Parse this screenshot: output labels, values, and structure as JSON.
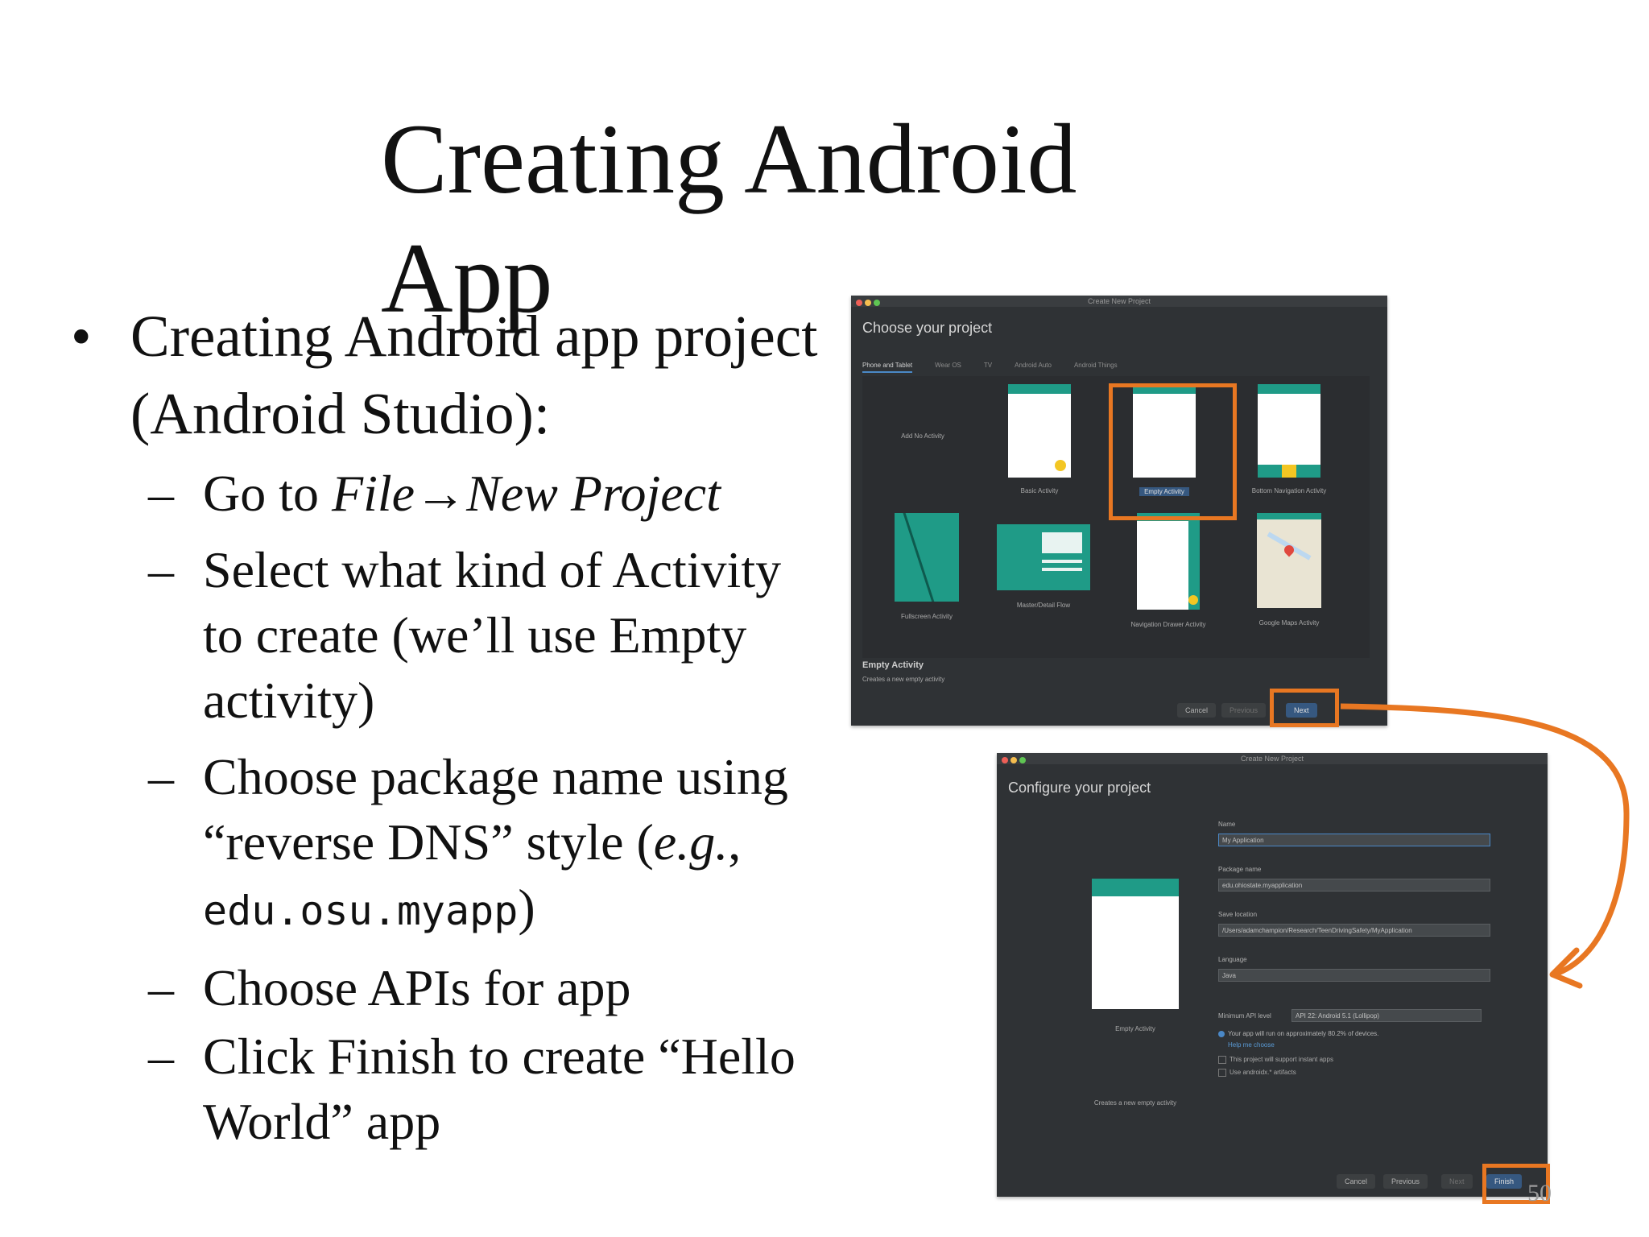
{
  "slide": {
    "title": "Creating Android App",
    "bullet_main_1": "Creating Android app project (Android Studio):",
    "sub1_prefix": "Go to ",
    "sub1_italic": "File→New Project",
    "sub2": "Select what kind of Activity to create (we’ll use Empty activity)",
    "sub3_text": "Choose package name using “reverse DNS” style (",
    "sub3_eg": "e.g.",
    "sub3_comma": ", ",
    "sub3_code": "edu.osu.myapp",
    "sub3_close": ")",
    "sub4": "Choose APIs for app",
    "sub5": "Click Finish to create “Hello World” app",
    "bullet_glyph": "•",
    "dash_glyph": "–",
    "page_number": "50"
  },
  "window1": {
    "titlebar": "Create New Project",
    "heading": "Choose your project",
    "tabs": [
      "Phone and Tablet",
      "Wear OS",
      "TV",
      "Android Auto",
      "Android Things"
    ],
    "tiles": [
      {
        "label": "Add No Activity",
        "icon": "no-activity"
      },
      {
        "label": "Basic Activity",
        "icon": "basic-activity"
      },
      {
        "label": "Empty Activity",
        "icon": "empty-activity"
      },
      {
        "label": "Bottom Navigation Activity",
        "icon": "bottom-nav-activity"
      },
      {
        "label": "Fullscreen Activity",
        "icon": "fullscreen-activity"
      },
      {
        "label": "Master/Detail Flow",
        "icon": "master-detail"
      },
      {
        "label": "Navigation Drawer Activity",
        "icon": "nav-drawer"
      },
      {
        "label": "Google Maps Activity",
        "icon": "maps"
      }
    ],
    "selected_title": "Empty Activity",
    "selected_desc": "Creates a new empty activity",
    "buttons": {
      "cancel": "Cancel",
      "previous": "Previous",
      "next": "Next"
    }
  },
  "window2": {
    "titlebar": "Create New Project",
    "heading": "Configure your project",
    "preview_label": "Empty Activity",
    "preview_desc": "Creates a new empty activity",
    "fields": {
      "name_label": "Name",
      "name_value": "My Application",
      "package_label": "Package name",
      "package_value": "edu.ohiostate.myapplication",
      "save_label": "Save location",
      "save_value": "/Users/adamchampion/Research/TeenDrivingSafety/MyApplication",
      "language_label": "Language",
      "language_value": "Java",
      "minapi_label": "Minimum API level",
      "minapi_value": "API 22: Android 5.1 (Lollipop)"
    },
    "info_text": "Your app will run on approximately 80.2% of devices.",
    "help_link": "Help me choose",
    "check1": "This project will support instant apps",
    "check2": "Use androidx.* artifacts",
    "buttons": {
      "cancel": "Cancel",
      "previous": "Previous",
      "next": "Next",
      "finish": "Finish"
    }
  },
  "colors": {
    "highlight": "#e87722",
    "teal": "#1f9b87",
    "accent_yellow": "#f3c623",
    "ide_bg": "#2f3235"
  }
}
